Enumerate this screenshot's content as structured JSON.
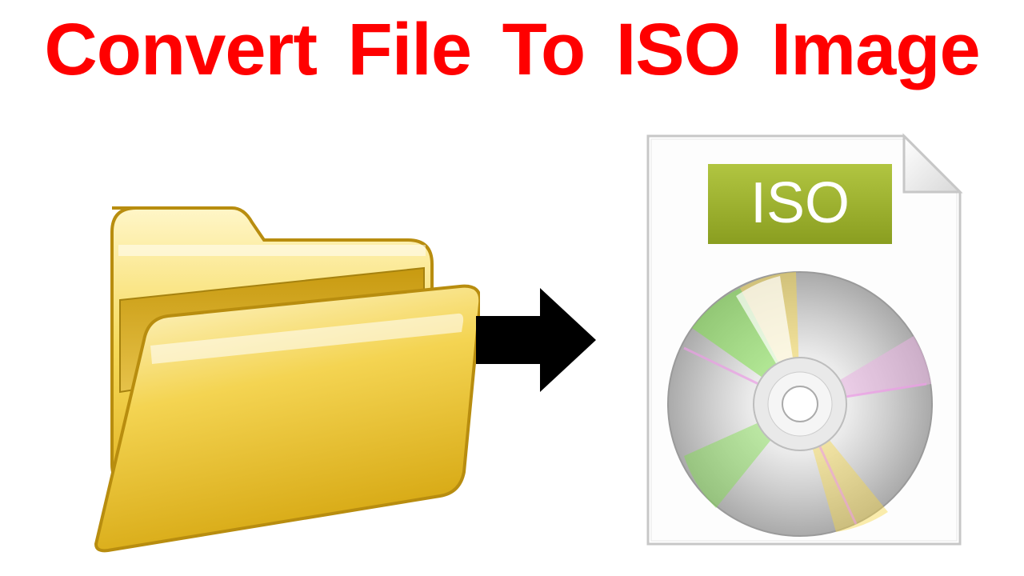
{
  "title": "Convert File To ISO Image",
  "iso_badge_text": "ISO",
  "icons": {
    "folder": "folder-icon",
    "arrow": "arrow-right-icon",
    "iso_file": "iso-file-icon",
    "disc": "disc-icon"
  },
  "colors": {
    "title": "#ff0000",
    "iso_badge_bg": "#9aae2a",
    "iso_badge_text": "#ffffff",
    "folder_light": "#fdf0a7",
    "folder_mid": "#f6da5a",
    "folder_dark": "#d7a914",
    "arrow": "#000000"
  }
}
